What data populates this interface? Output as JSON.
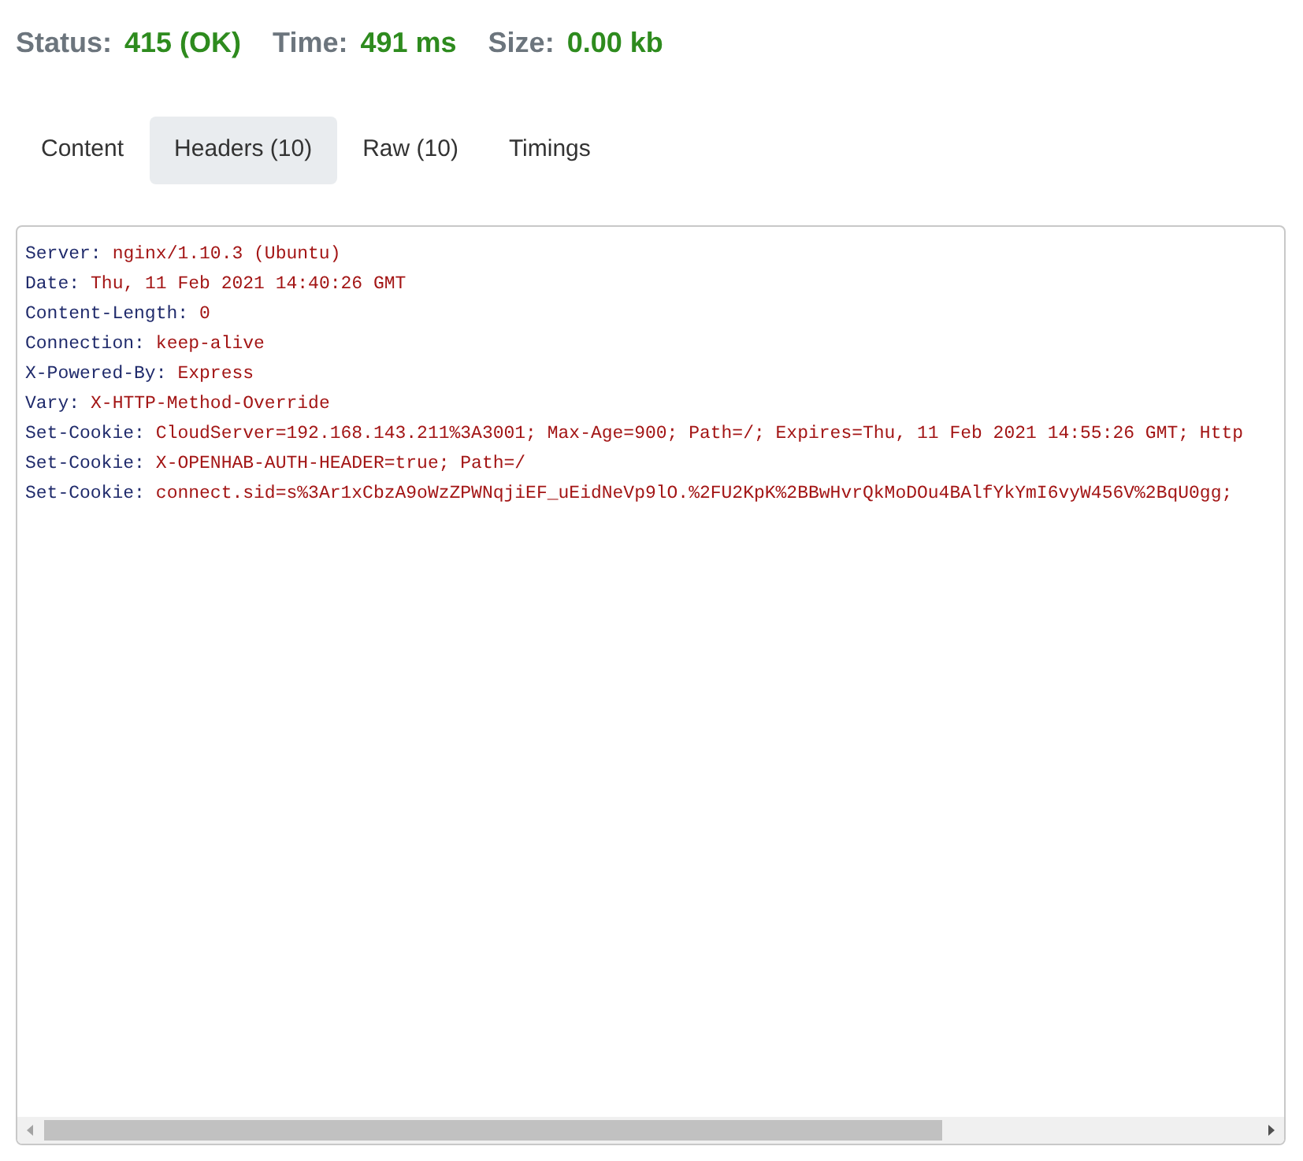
{
  "summary": [
    {
      "label": "Status:",
      "value": "415 (OK)"
    },
    {
      "label": "Time:",
      "value": "491 ms"
    },
    {
      "label": "Size:",
      "value": "0.00 kb"
    }
  ],
  "tabs": [
    {
      "label": "Content",
      "selected": false
    },
    {
      "label": "Headers (10)",
      "selected": true
    },
    {
      "label": "Raw (10)",
      "selected": false
    },
    {
      "label": "Timings",
      "selected": false
    }
  ],
  "headers": [
    {
      "name": "Server:",
      "value": "nginx/1.10.3 (Ubuntu)"
    },
    {
      "name": "Date:",
      "value": "Thu, 11 Feb 2021 14:40:26 GMT"
    },
    {
      "name": "Content-Length:",
      "value": "0"
    },
    {
      "name": "Connection:",
      "value": "keep-alive"
    },
    {
      "name": "X-Powered-By:",
      "value": "Express"
    },
    {
      "name": "Vary:",
      "value": "X-HTTP-Method-Override"
    },
    {
      "name": "Set-Cookie:",
      "value": "CloudServer=192.168.143.211%3A3001; Max-Age=900; Path=/; Expires=Thu, 11 Feb 2021 14:55:26 GMT; Http"
    },
    {
      "name": "Set-Cookie:",
      "value": "X-OPENHAB-AUTH-HEADER=true; Path=/"
    },
    {
      "name": "Set-Cookie:",
      "value": "connect.sid=s%3Ar1xCbzA9oWzZPWNqjiEF_uEidNeVp9lO.%2FU2KpK%2BBwHvrQkMoDOu4BAlfYkYmI6vyW456V%2BqU0gg;"
    }
  ]
}
